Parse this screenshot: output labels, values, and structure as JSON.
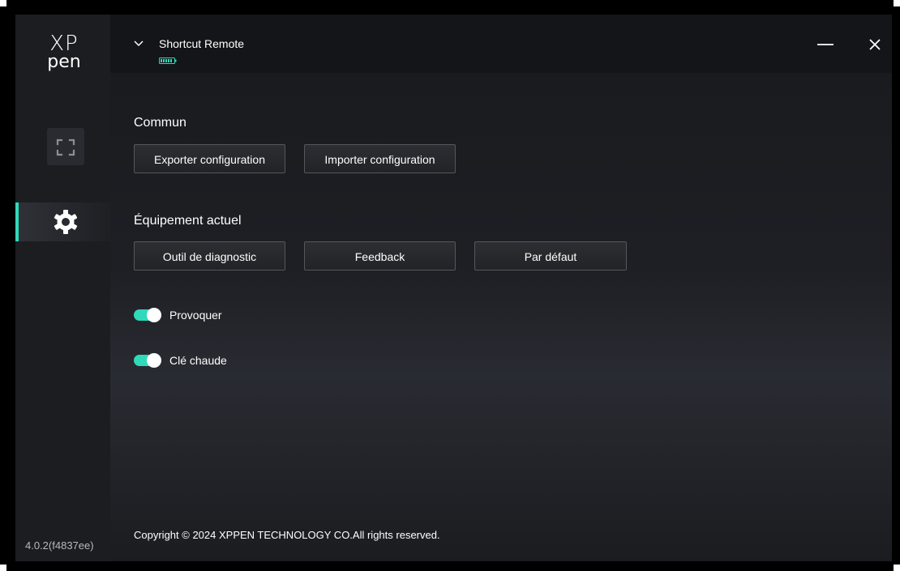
{
  "app": {
    "logo_line1": "XP",
    "logo_line2": "pen",
    "version": "4.0.2(f4837ee)",
    "accent_color": "#2fd9b9"
  },
  "sidebar": {
    "items": [
      {
        "name": "device",
        "icon": "device-frame-icon",
        "active": false
      },
      {
        "name": "settings",
        "icon": "gear-icon",
        "active": true
      }
    ]
  },
  "header": {
    "device_name": "Shortcut Remote",
    "dropdown_icon": "chevron-down-icon",
    "battery_icon": "battery-icon",
    "minimize_icon": "minimize-icon",
    "close_icon": "close-icon"
  },
  "main": {
    "common": {
      "title": "Commun",
      "export_label": "Exporter configuration",
      "import_label": "Importer configuration"
    },
    "current_device": {
      "title": "Équipement actuel",
      "diagnostic_label": "Outil de diagnostic",
      "feedback_label": "Feedback",
      "default_label": "Par défaut"
    },
    "toggles": [
      {
        "label": "Provoquer",
        "on": true
      },
      {
        "label": "Clé chaude",
        "on": true
      }
    ],
    "copyright": "Copyright © 2024  XPPEN TECHNOLOGY CO.All rights reserved."
  }
}
